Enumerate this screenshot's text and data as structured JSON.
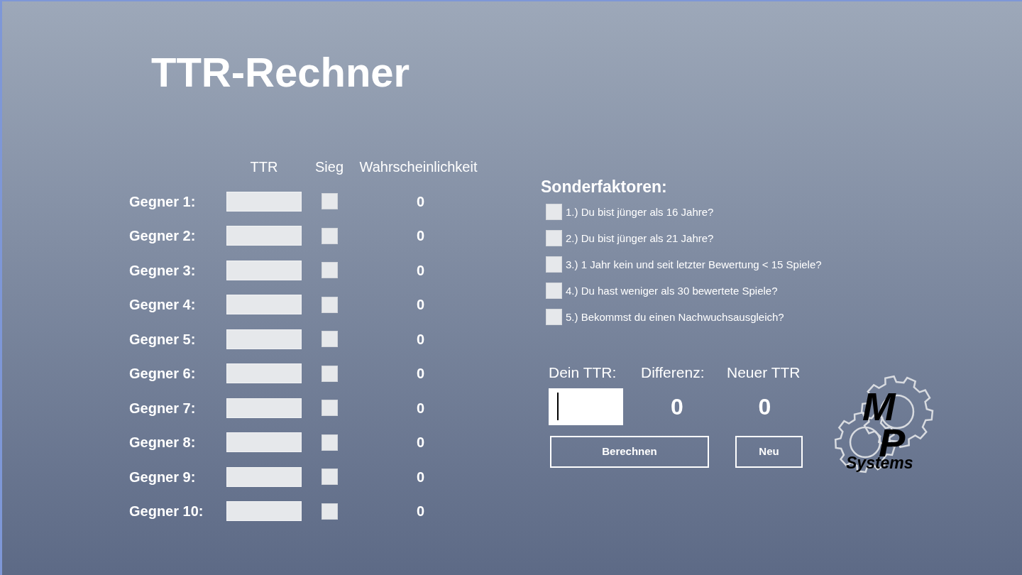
{
  "title": "TTR-Rechner",
  "opponents": {
    "column_headers": [
      "TTR",
      "Sieg",
      "Wahrscheinlichkeit"
    ],
    "rows": [
      {
        "label": "Gegner 1:",
        "checked": false,
        "probability": "0"
      },
      {
        "label": "Gegner 2:",
        "checked": false,
        "probability": "0"
      },
      {
        "label": "Gegner 3:",
        "checked": false,
        "probability": "0"
      },
      {
        "label": "Gegner 4:",
        "checked": false,
        "probability": "0"
      },
      {
        "label": "Gegner 5:",
        "checked": false,
        "probability": "0"
      },
      {
        "label": "Gegner 6:",
        "checked": false,
        "probability": "0"
      },
      {
        "label": "Gegner 7:",
        "checked": false,
        "probability": "0"
      },
      {
        "label": "Gegner 8:",
        "checked": false,
        "probability": "0"
      },
      {
        "label": "Gegner 9:",
        "checked": false,
        "probability": "0"
      },
      {
        "label": "Gegner 10:",
        "checked": false,
        "probability": "0"
      }
    ]
  },
  "special_factors": {
    "heading": "Sonderfaktoren:",
    "items": [
      {
        "label": "1.) Du bist jünger als 16 Jahre?",
        "checked": false
      },
      {
        "label": "2.) Du bist jünger als 21 Jahre?",
        "checked": false
      },
      {
        "label": "3.) 1 Jahr kein und seit letzter Bewertung < 15 Spiele?",
        "checked": false
      },
      {
        "label": "4.) Du hast weniger als 30 bewertete Spiele?",
        "checked": false
      },
      {
        "label": "5.) Bekommst du einen Nachwuchsausgleich?",
        "checked": false
      }
    ]
  },
  "result": {
    "own_ttr": {
      "label": "Dein TTR:",
      "focused": true
    },
    "difference": {
      "label": "Differenz:",
      "value": "0"
    },
    "new_ttr": {
      "label": "Neuer TTR",
      "value": "0"
    }
  },
  "buttons": [
    {
      "label": "Berechnen"
    },
    {
      "label": "Neu"
    }
  ],
  "logo": {
    "initials": [
      "M",
      "P"
    ],
    "wordmark": "Systems"
  }
}
